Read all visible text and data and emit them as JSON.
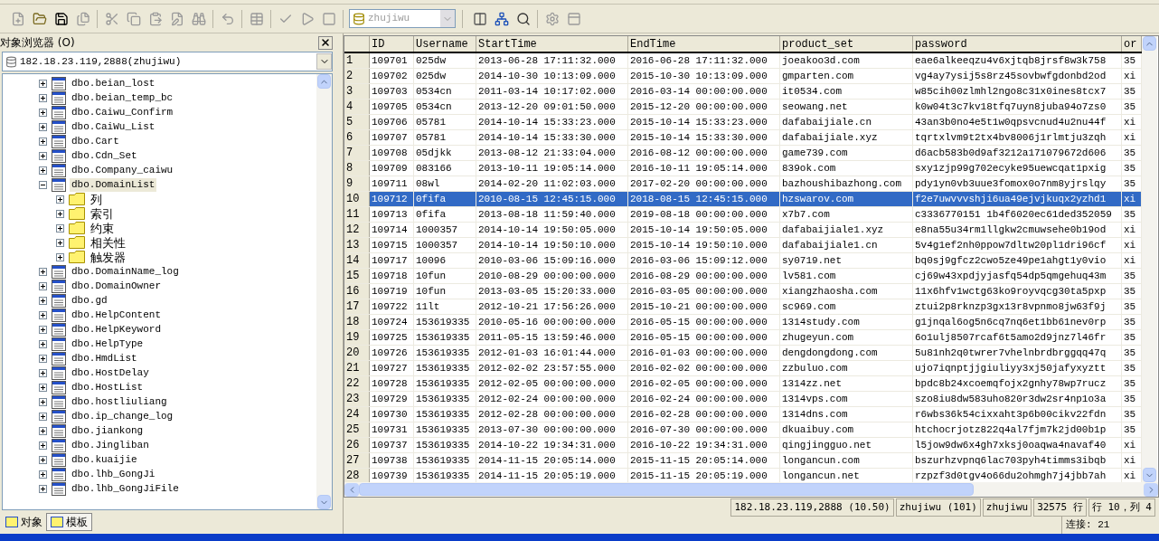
{
  "toolbar": {
    "database": "zhujiwu"
  },
  "object_browser": {
    "title": "对象浏览器 (O)",
    "server": "182.18.23.119,2888(zhujiwu)",
    "tree": [
      {
        "label": "dbo.beian_lost",
        "kind": "table",
        "expanded": false,
        "selected": false
      },
      {
        "label": "dbo.beian_temp_bc",
        "kind": "table",
        "expanded": false,
        "selected": false
      },
      {
        "label": "dbo.Caiwu_Confirm",
        "kind": "table",
        "expanded": false,
        "selected": false
      },
      {
        "label": "dbo.CaiWu_List",
        "kind": "table",
        "expanded": false,
        "selected": false
      },
      {
        "label": "dbo.Cart",
        "kind": "table",
        "expanded": false,
        "selected": false
      },
      {
        "label": "dbo.Cdn_Set",
        "kind": "table",
        "expanded": false,
        "selected": false
      },
      {
        "label": "dbo.Company_caiwu",
        "kind": "table",
        "expanded": false,
        "selected": false
      },
      {
        "label": "dbo.DomainList",
        "kind": "table",
        "expanded": true,
        "selected": true,
        "children": [
          {
            "label": "列",
            "kind": "folder",
            "expanded": false,
            "selected": false
          },
          {
            "label": "索引",
            "kind": "folder",
            "expanded": false,
            "selected": false
          },
          {
            "label": "约束",
            "kind": "folder",
            "expanded": false,
            "selected": false
          },
          {
            "label": "相关性",
            "kind": "folder",
            "expanded": false,
            "selected": false
          },
          {
            "label": "触发器",
            "kind": "folder",
            "expanded": false,
            "selected": false
          }
        ]
      },
      {
        "label": "dbo.DomainName_log",
        "kind": "table",
        "expanded": false,
        "selected": false
      },
      {
        "label": "dbo.DomainOwner",
        "kind": "table",
        "expanded": false,
        "selected": false
      },
      {
        "label": "dbo.gd",
        "kind": "table",
        "expanded": false,
        "selected": false
      },
      {
        "label": "dbo.HelpContent",
        "kind": "table",
        "expanded": false,
        "selected": false
      },
      {
        "label": "dbo.HelpKeyword",
        "kind": "table",
        "expanded": false,
        "selected": false
      },
      {
        "label": "dbo.HelpType",
        "kind": "table",
        "expanded": false,
        "selected": false
      },
      {
        "label": "dbo.HmdList",
        "kind": "table",
        "expanded": false,
        "selected": false
      },
      {
        "label": "dbo.HostDelay",
        "kind": "table",
        "expanded": false,
        "selected": false
      },
      {
        "label": "dbo.HostList",
        "kind": "table",
        "expanded": false,
        "selected": false
      },
      {
        "label": "dbo.hostliuliang",
        "kind": "table",
        "expanded": false,
        "selected": false
      },
      {
        "label": "dbo.ip_change_log",
        "kind": "table",
        "expanded": false,
        "selected": false
      },
      {
        "label": "dbo.jiankong",
        "kind": "table",
        "expanded": false,
        "selected": false
      },
      {
        "label": "dbo.Jingliban",
        "kind": "table",
        "expanded": false,
        "selected": false
      },
      {
        "label": "dbo.kuaijie",
        "kind": "table",
        "expanded": false,
        "selected": false
      },
      {
        "label": "dbo.lhb_GongJi",
        "kind": "table",
        "expanded": false,
        "selected": false
      },
      {
        "label": "dbo.lhb_GongJiFile",
        "kind": "table",
        "expanded": false,
        "selected": false
      }
    ],
    "tabs": [
      {
        "label": "对象",
        "selected": false
      },
      {
        "label": "模板",
        "selected": true
      }
    ]
  },
  "grid": {
    "columns": [
      "ID",
      "Username",
      "StartTime",
      "EndTime",
      "product_set",
      "password",
      "or"
    ],
    "rows": [
      {
        "number": "1",
        "selected": false,
        "cells": [
          "109701",
          "025dw",
          "2013-06-28 17:11:32.000",
          "2016-06-28 17:11:32.000",
          "joeakoo3d.com",
          "eae6alkeeqzu4v6xjtqb8jrsf8w3k758",
          "35"
        ]
      },
      {
        "number": "2",
        "selected": false,
        "cells": [
          "109702",
          "025dw",
          "2014-10-30 10:13:09.000",
          "2015-10-30 10:13:09.000",
          "gmparten.com",
          "vg4ay7ysij5s8rz45sovbwfgdonbd2od",
          "xi"
        ]
      },
      {
        "number": "3",
        "selected": false,
        "cells": [
          "109703",
          "0534cn",
          "2011-03-14 10:17:02.000",
          "2016-03-14 00:00:00.000",
          "it0534.com",
          "w85cih00zlmhl2ngo8c31x0ines8tcx7",
          "35"
        ]
      },
      {
        "number": "4",
        "selected": false,
        "cells": [
          "109705",
          "0534cn",
          "2013-12-20 09:01:50.000",
          "2015-12-20 00:00:00.000",
          "seowang.net",
          "k0w04t3c7kv18tfq7uyn8juba94o7zs0",
          "35"
        ]
      },
      {
        "number": "5",
        "selected": false,
        "cells": [
          "109706",
          "05781",
          "2014-10-14 15:33:23.000",
          "2015-10-14 15:33:23.000",
          "dafabaijiale.cn",
          "43an3b0no4e5t1w0qpsvcnud4u2nu44f",
          "xi"
        ]
      },
      {
        "number": "6",
        "selected": false,
        "cells": [
          "109707",
          "05781",
          "2014-10-14 15:33:30.000",
          "2015-10-14 15:33:30.000",
          "dafabaijiale.xyz",
          "tqrtxlvm9t2tx4bv8006j1rlmtju3zqh",
          "xi"
        ]
      },
      {
        "number": "7",
        "selected": false,
        "cells": [
          "109708",
          "05djkk",
          "2013-08-12 21:33:04.000",
          "2016-08-12 00:00:00.000",
          "game739.com",
          "d6acb583b0d9af3212a171079672d606",
          "35"
        ]
      },
      {
        "number": "8",
        "selected": false,
        "cells": [
          "109709",
          "083166",
          "2013-10-11 19:05:14.000",
          "2016-10-11 19:05:14.000",
          "839ok.com",
          "sxy1zjp99g702ecyke95uewcqat1pxig",
          "35"
        ]
      },
      {
        "number": "9",
        "selected": false,
        "cells": [
          "109711",
          "08wl",
          "2014-02-20 11:02:03.000",
          "2017-02-20 00:00:00.000",
          "bazhoushibazhong.com",
          "pdy1yn0vb3uue3fomox0o7nm8yjrslqy",
          "35"
        ]
      },
      {
        "number": "10",
        "selected": true,
        "cells": [
          "109712",
          "0fifa",
          "2010-08-15 12:45:15.000",
          "2018-08-15 12:45:15.000",
          "hzswarov.com",
          "f2e7uwvvvshji6ua49ejvjkuqx2yzhd1",
          "xi"
        ]
      },
      {
        "number": "11",
        "selected": false,
        "cells": [
          "109713",
          "0fifa",
          "2013-08-18 11:59:40.000",
          "2019-08-18 00:00:00.000",
          "x7b7.com",
          "c3336770151 1b4f6020ec61ded352059",
          "35"
        ]
      },
      {
        "number": "12",
        "selected": false,
        "cells": [
          "109714",
          "1000357",
          "2014-10-14 19:50:05.000",
          "2015-10-14 19:50:05.000",
          "dafabaijiale1.xyz",
          "e8na55u34rm1llgkw2cmuwsehe0b19od",
          "xi"
        ]
      },
      {
        "number": "13",
        "selected": false,
        "cells": [
          "109715",
          "1000357",
          "2014-10-14 19:50:10.000",
          "2015-10-14 19:50:10.000",
          "dafabaijiale1.cn",
          "5v4g1ef2nh0ppow7dltw20pl1dri96cf",
          "xi"
        ]
      },
      {
        "number": "14",
        "selected": false,
        "cells": [
          "109717",
          "10096",
          "2010-03-06 15:09:16.000",
          "2016-03-06 15:09:12.000",
          "sy0719.net",
          "bq0sj9gfcz2cwo5ze49pe1ahgt1y0vio",
          "xi"
        ]
      },
      {
        "number": "15",
        "selected": false,
        "cells": [
          "109718",
          "10fun",
          "2010-08-29 00:00:00.000",
          "2016-08-29 00:00:00.000",
          "lv581.com",
          "cj69w43xpdjyjasfq54dp5qmgehuq43m",
          "35"
        ]
      },
      {
        "number": "16",
        "selected": false,
        "cells": [
          "109719",
          "10fun",
          "2013-03-05 15:20:33.000",
          "2016-03-05 00:00:00.000",
          "xiangzhaosha.com",
          "11x6hfv1wctg63ko9royvqcg30ta5pxp",
          "35"
        ]
      },
      {
        "number": "17",
        "selected": false,
        "cells": [
          "109722",
          "11lt",
          "2012-10-21 17:56:26.000",
          "2015-10-21 00:00:00.000",
          "sc969.com",
          "ztui2p8rknzp3gx13r8vpnmo8jw63f9j",
          "35"
        ]
      },
      {
        "number": "18",
        "selected": false,
        "cells": [
          "109724",
          "153619335",
          "2010-05-16 00:00:00.000",
          "2016-05-15 00:00:00.000",
          "1314study.com",
          "g1jnqal6og5n6cq7nq6et1bb61nev0rp",
          "35"
        ]
      },
      {
        "number": "19",
        "selected": false,
        "cells": [
          "109725",
          "153619335",
          "2011-05-15 13:59:46.000",
          "2016-05-15 00:00:00.000",
          "zhugeyun.com",
          "6o1ulj8507rcaf6t5amo2d9jnz7l46fr",
          "35"
        ]
      },
      {
        "number": "20",
        "selected": false,
        "cells": [
          "109726",
          "153619335",
          "2012-01-03 16:01:44.000",
          "2016-01-03 00:00:00.000",
          "dengdongdong.com",
          "5u81nh2q0twrer7vhelnbrdbrggqq47q",
          "35"
        ]
      },
      {
        "number": "21",
        "selected": false,
        "cells": [
          "109727",
          "153619335",
          "2012-02-02 23:57:55.000",
          "2016-02-02 00:00:00.000",
          "zzbuluo.com",
          "ujo7iqnptjjgiuliyy3xj50jafyxyztt",
          "35"
        ]
      },
      {
        "number": "22",
        "selected": false,
        "cells": [
          "109728",
          "153619335",
          "2012-02-05 00:00:00.000",
          "2016-02-05 00:00:00.000",
          "1314zz.net",
          "bpdc8b24xcoemqfojx2gnhy78wp7rucz",
          "35"
        ]
      },
      {
        "number": "23",
        "selected": false,
        "cells": [
          "109729",
          "153619335",
          "2012-02-24 00:00:00.000",
          "2016-02-24 00:00:00.000",
          "1314vps.com",
          "szo8iu8dw583uho820r3dw2sr4np1o3a",
          "35"
        ]
      },
      {
        "number": "24",
        "selected": false,
        "cells": [
          "109730",
          "153619335",
          "2012-02-28 00:00:00.000",
          "2016-02-28 00:00:00.000",
          "1314dns.com",
          "r6wbs36k54cixxaht3p6b00cikv22fdn",
          "35"
        ]
      },
      {
        "number": "25",
        "selected": false,
        "cells": [
          "109731",
          "153619335",
          "2013-07-30 00:00:00.000",
          "2016-07-30 00:00:00.000",
          "dkuaibuy.com",
          "htchocrjotz822q4al7fjm7k2jd00b1p",
          "35"
        ]
      },
      {
        "number": "26",
        "selected": false,
        "cells": [
          "109737",
          "153619335",
          "2014-10-22 19:34:31.000",
          "2016-10-22 19:34:31.000",
          "qingjingguo.net",
          "l5jow9dw6x4gh7xksj0oaqwa4navaf40",
          "xi"
        ]
      },
      {
        "number": "27",
        "selected": false,
        "cells": [
          "109738",
          "153619335",
          "2014-11-15 20:05:14.000",
          "2015-11-15 20:05:14.000",
          "longancun.com",
          "bszurhzvpnq6lac703pyh4timms3ibqb",
          "xi"
        ]
      },
      {
        "number": "28",
        "selected": false,
        "cells": [
          "109739",
          "153619335",
          "2014-11-15 20:05:19.000",
          "2015-11-15 20:05:19.000",
          "longancun.net",
          "rzpzf3d0tgv4o66du2ohmgh7j4jbb7ah",
          "xi"
        ]
      }
    ]
  },
  "status_bar": {
    "panels": [
      "182.18.23.119,2888 (10.50)",
      "zhujiwu (101)",
      "zhujiwu",
      "32575 行",
      "行 10，列 4"
    ],
    "connections": "连接: 21"
  }
}
